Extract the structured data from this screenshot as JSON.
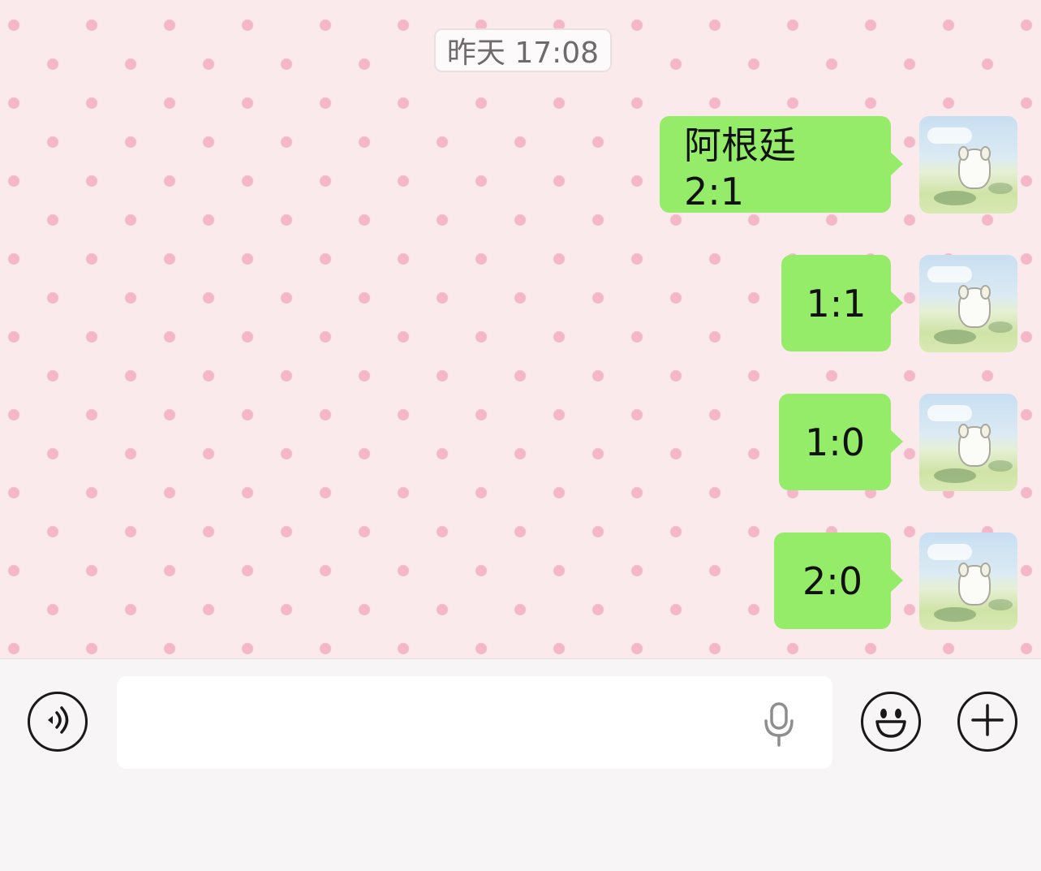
{
  "chat": {
    "timestamp": "昨天 17:08",
    "messages": [
      {
        "text": "阿根廷 2:1",
        "direction": "outgoing"
      },
      {
        "text": "1:1",
        "direction": "outgoing"
      },
      {
        "text": "1:0",
        "direction": "outgoing"
      },
      {
        "text": "2:0",
        "direction": "outgoing"
      }
    ],
    "bubble_color": "#95ec69",
    "wallpaper_color": "#fbeaec",
    "dot_color": "#f4b9c8"
  },
  "input_bar": {
    "icons": [
      "voice-toggle-icon",
      "microphone-icon",
      "emoji-icon",
      "plus-icon"
    ],
    "text_value": ""
  }
}
